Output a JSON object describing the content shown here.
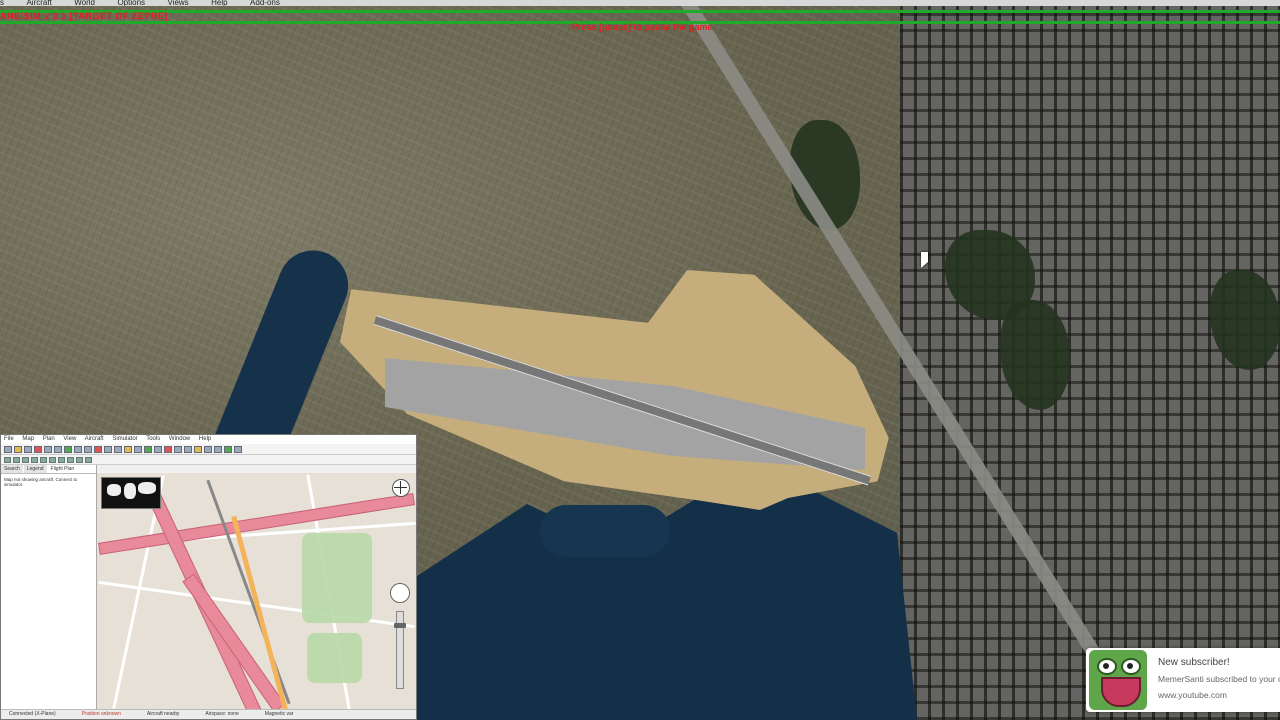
{
  "sim": {
    "menu": [
      "s",
      "Aircraft",
      "World",
      "Options",
      "Views",
      "Help",
      "Add-ons"
    ],
    "version_text": "ANE/SIM v 2.1   [TARGET OF ZEPRE]",
    "message_text": "Press [pause] to pause the game"
  },
  "map_window": {
    "menu": [
      "File",
      "Map",
      "Plan",
      "View",
      "Aircraft",
      "Simulator",
      "Tools",
      "Window",
      "Help"
    ],
    "tabs": [
      "Search",
      "Legend",
      "Flight Plan"
    ],
    "panel_note": "Map not showing aircraft. Connect to simulator",
    "zoom_level": 0.15,
    "status": [
      "Connected (X-Plane)",
      "Position unknown",
      "Aircraft nearby",
      "Airspace: none",
      "Magnetic var"
    ]
  },
  "toast": {
    "title": "New subscriber!",
    "body": "MemerSanti subscribed to your channel",
    "url": "www.youtube.com"
  },
  "colors": {
    "status_green": "#1faa2a",
    "status_text": "#e02020",
    "highway_pink": "#e88a9a"
  }
}
